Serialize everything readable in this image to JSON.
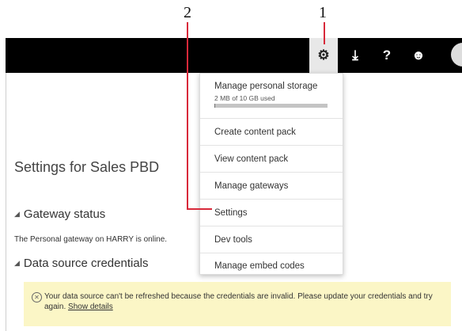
{
  "callouts": {
    "one": "1",
    "two": "2"
  },
  "topbar": {
    "settings_glyph": "⚙",
    "download_glyph": "⤓",
    "help_glyph": "?",
    "feedback_glyph": "☻"
  },
  "page": {
    "title": "Settings for Sales PBD",
    "gateway_section": "Gateway status",
    "gateway_message": "The Personal gateway on HARRY is online.",
    "credentials_section": "Data source credentials"
  },
  "warning": {
    "icon_glyph": "✕",
    "message": "Your data source can't be refreshed because the credentials are invalid. Please update your credentials and try again.",
    "link": "Show details"
  },
  "menu": {
    "storage": {
      "title": "Manage personal storage",
      "usage": "2 MB of 10 GB used",
      "used_fraction": 0.0002
    },
    "items": [
      "Create content pack",
      "View content pack",
      "Manage gateways",
      "Settings",
      "Dev tools",
      "Manage embed codes"
    ]
  },
  "colors": {
    "topbar": "#000000",
    "warning_bg": "#fbf6c6",
    "callout_line": "#d8293a"
  }
}
